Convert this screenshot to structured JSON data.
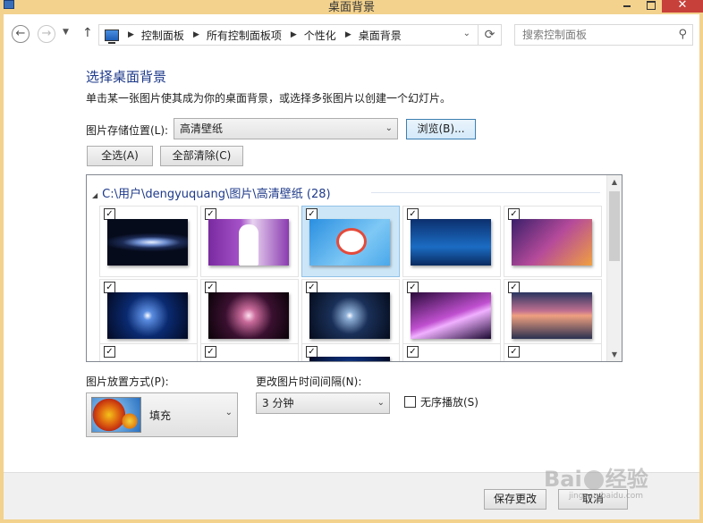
{
  "window": {
    "title": "桌面背景"
  },
  "nav": {
    "back_glyph": "←",
    "forward_glyph": "→",
    "dropdown_glyph": "▼",
    "up_glyph": "↑",
    "breadcrumbs": [
      "控制面板",
      "所有控制面板项",
      "个性化",
      "桌面背景"
    ],
    "search_placeholder": "搜索控制面板"
  },
  "content": {
    "heading": "选择桌面背景",
    "subtitle": "单击某一张图片使其成为你的桌面背景，或选择多张图片以创建一个幻灯片。",
    "location_label": "图片存储位置(L):",
    "location_value": "高清壁纸",
    "browse_label": "浏览(B)...",
    "select_all_label": "全选(A)",
    "clear_all_label": "全部清除(C)"
  },
  "group": {
    "title": "C:\\用户\\dengyuquang\\图片\\高清壁纸 (28)",
    "tiles": [
      {
        "checked": true,
        "selected": false
      },
      {
        "checked": true,
        "selected": false
      },
      {
        "checked": true,
        "selected": true
      },
      {
        "checked": true,
        "selected": false
      },
      {
        "checked": true,
        "selected": false
      },
      {
        "checked": true,
        "selected": false
      },
      {
        "checked": true,
        "selected": false
      },
      {
        "checked": true,
        "selected": false
      },
      {
        "checked": true,
        "selected": false
      },
      {
        "checked": true,
        "selected": false
      },
      {
        "checked": true,
        "selected": false
      },
      {
        "checked": true,
        "selected": false
      },
      {
        "checked": true,
        "selected": false
      },
      {
        "checked": true,
        "selected": false
      },
      {
        "checked": true,
        "selected": false
      }
    ]
  },
  "options": {
    "position_label": "图片放置方式(P):",
    "position_value": "填充",
    "interval_label": "更改图片时间间隔(N):",
    "interval_value": "3 分钟",
    "shuffle_label": "无序播放(S)",
    "shuffle_checked": false
  },
  "footer": {
    "save_label": "保存更改",
    "cancel_label": "取消"
  },
  "watermark": {
    "text": "Bai",
    "text2": "经验",
    "sub": "jingyan.baidu.com"
  },
  "colors": {
    "titlebar": "#f3d28d",
    "close_button": "#c7403a",
    "heading_blue": "#1e3a8a",
    "selected_tile": "#cde6f7"
  }
}
